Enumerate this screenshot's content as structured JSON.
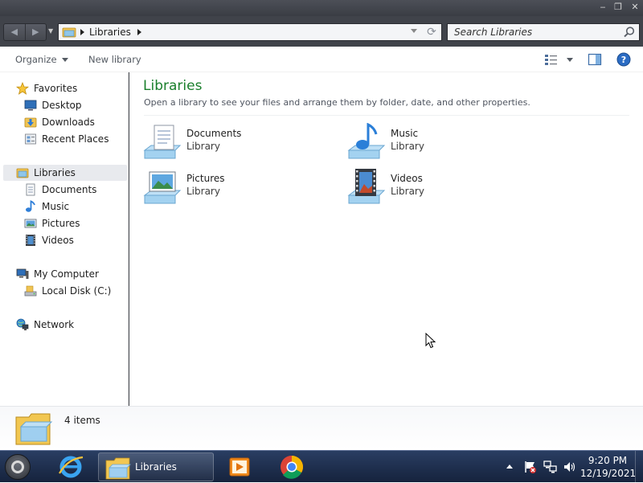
{
  "window": {
    "controls": {
      "minimize": "‒",
      "restore": "❐",
      "close": "✕"
    }
  },
  "navbar": {
    "back_icon": "back-arrow-icon",
    "forward_icon": "forward-arrow-icon",
    "breadcrumb": [
      "Libraries"
    ],
    "search_placeholder": "Search Libraries"
  },
  "toolbar": {
    "organize_label": "Organize",
    "new_library_label": "New library"
  },
  "navpane": {
    "favorites": {
      "label": "Favorites",
      "items": [
        "Desktop",
        "Downloads",
        "Recent Places"
      ]
    },
    "libraries": {
      "label": "Libraries",
      "items": [
        "Documents",
        "Music",
        "Pictures",
        "Videos"
      ]
    },
    "computer": {
      "label": "My Computer",
      "items": [
        "Local Disk (C:)"
      ]
    },
    "network": {
      "label": "Network"
    }
  },
  "content": {
    "title": "Libraries",
    "subtitle": "Open a library to see your files and arrange them by folder, date, and other properties.",
    "libraries": [
      {
        "name": "Documents",
        "type": "Library"
      },
      {
        "name": "Music",
        "type": "Library"
      },
      {
        "name": "Pictures",
        "type": "Library"
      },
      {
        "name": "Videos",
        "type": "Library"
      }
    ]
  },
  "details": {
    "count": "4 items"
  },
  "taskbar": {
    "explorer_label": "Libraries",
    "time": "9:20 PM",
    "date": "12/19/2021"
  },
  "colors": {
    "accent_title": "#1a7f2c",
    "taskbar": "#1d2d4b",
    "window_frame": "#40434a"
  }
}
